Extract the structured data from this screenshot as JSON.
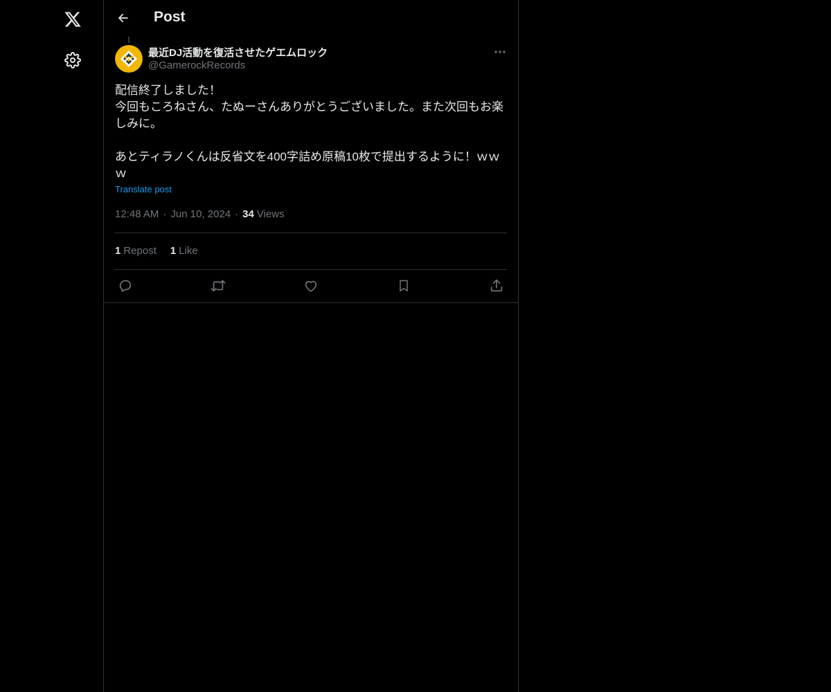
{
  "header": {
    "title": "Post"
  },
  "author": {
    "display_name": "最近DJ活動を復活させたゲエムロック",
    "handle": "@GamerockRecords"
  },
  "post": {
    "text": "配信終了しました！\n今回もころねさん、たぬーさんありがとうございました。また次回もお楽しみに。\n\nあとティラノくんは反省文を400字詰め原稿10枚で提出するように！ｗｗｗ",
    "translate_label": "Translate post",
    "time": "12:48 AM",
    "date": "Jun 10, 2024",
    "views_count": "34",
    "views_label": "Views"
  },
  "stats": {
    "reposts_count": "1",
    "reposts_label": "Repost",
    "likes_count": "1",
    "likes_label": "Like"
  },
  "separator": "·",
  "icons": {
    "nav": [
      "x-logo-icon",
      "settings-icon"
    ],
    "actions": [
      "reply-icon",
      "repost-icon",
      "like-icon",
      "bookmark-icon",
      "share-icon"
    ]
  },
  "colors": {
    "background": "#000000",
    "text": "#e7e9ea",
    "secondary": "#71767b",
    "link": "#1d9bf0",
    "border": "#2f3336"
  }
}
